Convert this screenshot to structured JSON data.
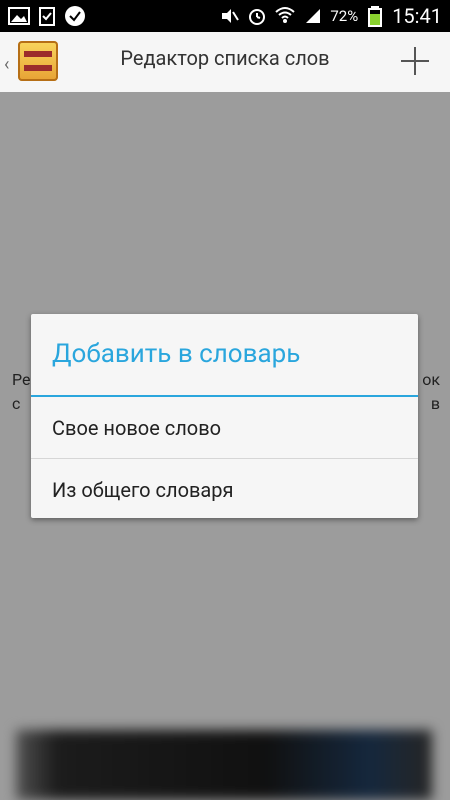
{
  "status_bar": {
    "icons_left": [
      "gallery-icon",
      "clipboard-check-icon",
      "checkmark-bubble-icon"
    ],
    "icons_right": [
      "mute-icon",
      "alarm-icon",
      "wifi-icon",
      "signal-icon",
      "battery-icon"
    ],
    "battery_percent": "72%",
    "time": "15:41"
  },
  "action_bar": {
    "title": "Редактор списка слов"
  },
  "content": {
    "left_fragments": [
      "Ре",
      "с"
    ],
    "right_fragments": [
      "ок",
      "в"
    ]
  },
  "dialog": {
    "title": "Добавить в словарь",
    "items": [
      "Свое новое слово",
      "Из общего словаря"
    ]
  },
  "colors": {
    "accent": "#2aa6dd",
    "statusbar_bg": "#000000",
    "actionbar_bg": "#f6f6f6",
    "dialog_bg": "#f6f6f6"
  }
}
